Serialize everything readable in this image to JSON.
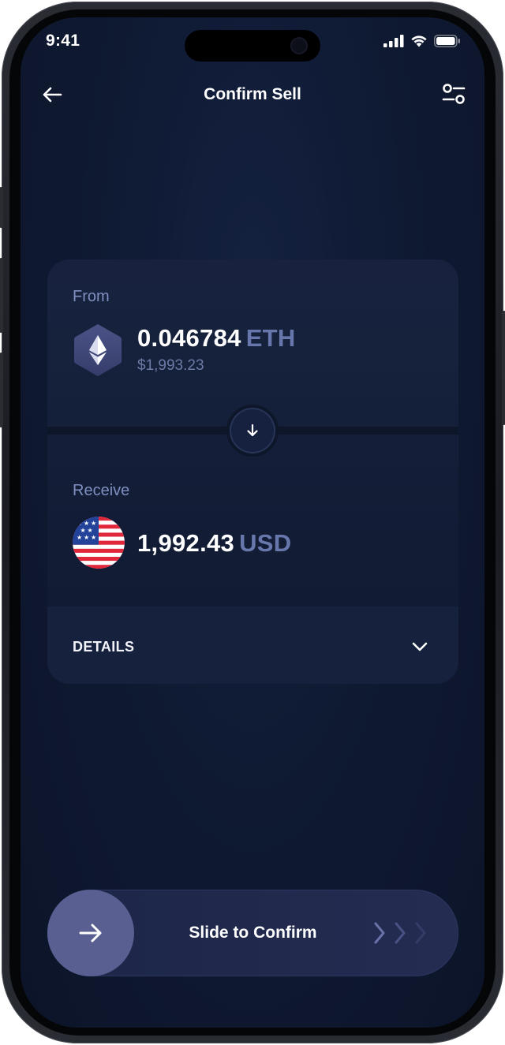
{
  "status_bar": {
    "time": "9:41"
  },
  "header": {
    "title": "Confirm Sell"
  },
  "from": {
    "label": "From",
    "amount": "0.046784",
    "currency": "ETH",
    "fiat_value": "$1,993.23"
  },
  "receive": {
    "label": "Receive",
    "amount": "1,992.43",
    "currency": "USD"
  },
  "details": {
    "label": "DETAILS"
  },
  "slider": {
    "label": "Slide to Confirm"
  },
  "colors": {
    "background": "#0f1a33",
    "card": "#15203b",
    "muted_text": "#7f8fbf",
    "currency_accent": "#6777ab",
    "slider_knob": "#5a5f92"
  },
  "icons": [
    "back-arrow-icon",
    "settings-sliders-icon",
    "ethereum-icon",
    "arrow-down-icon",
    "us-flag-icon",
    "chevron-down-icon",
    "arrow-right-icon",
    "chevron-right-icon"
  ]
}
